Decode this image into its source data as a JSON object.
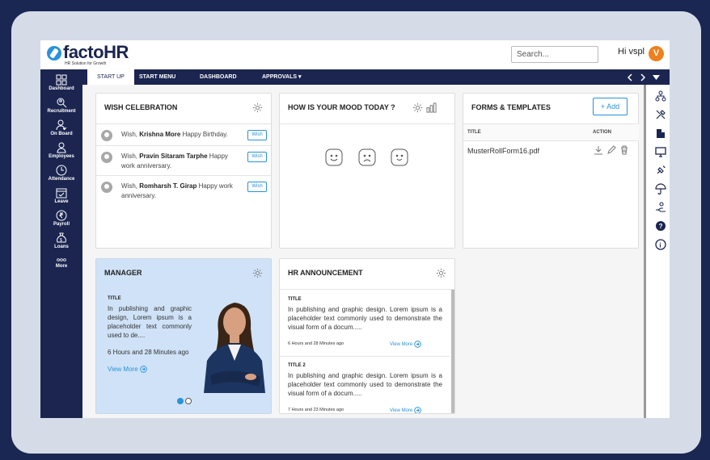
{
  "brand": {
    "name_a": "facto",
    "name_b": "HR",
    "tagline": "HR Solution for Growth"
  },
  "header": {
    "search_placeholder": "Search...",
    "greeting": "Hi vspl",
    "avatar_initial": "V"
  },
  "tabs": [
    {
      "label": "START UP"
    },
    {
      "label": "START MENU"
    },
    {
      "label": "DASHBOARD"
    },
    {
      "label": "APPROVALS ▾"
    }
  ],
  "sidebar": {
    "items": [
      {
        "label": "Dashboard",
        "icon": "grid-icon"
      },
      {
        "label": "Recruitment",
        "icon": "search-user-icon"
      },
      {
        "label": "On Board",
        "icon": "user-check-icon"
      },
      {
        "label": "Employees",
        "icon": "user-icon"
      },
      {
        "label": "Attendance",
        "icon": "clock-icon"
      },
      {
        "label": "Leave",
        "icon": "calendar-icon"
      },
      {
        "label": "Payroll",
        "icon": "rupee-icon"
      },
      {
        "label": "Loans",
        "icon": "money-bag-icon"
      },
      {
        "label": "More",
        "icon": "more-icon"
      }
    ]
  },
  "wish": {
    "title": "WISH CELEBRATION",
    "button": "Wish",
    "items": [
      {
        "pre": "Wish, ",
        "name": "Krishna More",
        "post": " Happy Birthday."
      },
      {
        "pre": "Wish, ",
        "name": "Pravin Sitaram Tarphe",
        "post": " Happy work anniversary."
      },
      {
        "pre": "Wish, ",
        "name": "Romharsh T. Girap",
        "post": " Happy work anniversary."
      }
    ]
  },
  "mood": {
    "title": "HOW IS YOUR MOOD TODAY ?"
  },
  "forms": {
    "title": "FORMS & TEMPLATES",
    "add_label": "+ Add",
    "col_title": "TITLE",
    "col_action": "ACTION",
    "rows": [
      {
        "title": "MusterRollForm16.pdf"
      }
    ]
  },
  "manager": {
    "title": "MANAGER",
    "item_title": "TITLE",
    "text": "In publishing and graphic design, Lorem ipsum is a placeholder text commonly used to de....",
    "time": "6 Hours and 28 Minutes ago",
    "link": "View More"
  },
  "announcement": {
    "title": "HR ANNOUNCEMENT",
    "items": [
      {
        "title": "TITLE",
        "text": "In publishing and graphic design. Lorem ipsum is a placeholder text commonly used to demonstrate the visual form of a docum.....",
        "time": "6 Hours and 28 Minutes ago",
        "link": "View More"
      },
      {
        "title": "TITLE 2",
        "text": "In publishing and graphic design. Lorem ipsum is a placeholder text commonly used to demonstrate the visual form of a docum.....",
        "time": "7 Hours and 23 Minutes ago",
        "link": "View More"
      }
    ]
  },
  "colors": {
    "navy": "#1b2550",
    "accent": "#2a92d8",
    "avatar": "#f0801e",
    "manager_bg": "#cfe2f7"
  }
}
